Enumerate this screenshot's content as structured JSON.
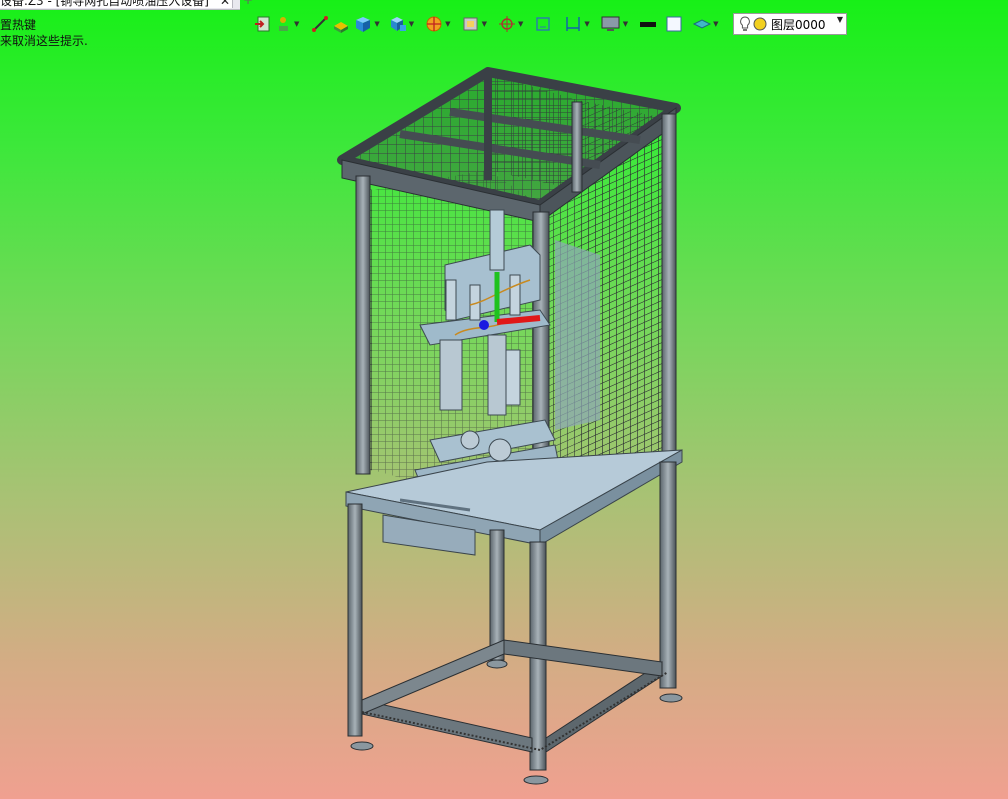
{
  "tab": {
    "title": "设备.Z3 - [铜导网孔自动喷油压入设备]",
    "close": "✕",
    "new_tab": "+"
  },
  "hints": [
    "置热键",
    "来取消这些提示."
  ],
  "toolbar": {
    "icons": [
      "exit-sketch-icon",
      "point-icon",
      "line-icon",
      "extrude-icon",
      "cube-icon",
      "solid-icon",
      "sphere-icon",
      "shell-icon",
      "datum-icon",
      "frame-icon",
      "dimension-icon",
      "display-icon",
      "black-color-icon",
      "white-color-icon",
      "layer-shape-icon"
    ]
  },
  "layer": {
    "name": "图层0000",
    "arrow": "▼"
  },
  "colors": {
    "bg_top": "#17f017",
    "bg_bottom": "#f0a090",
    "frame": "#7e8a92",
    "frame_dark": "#3a4248",
    "part": "#a9c4d6"
  }
}
